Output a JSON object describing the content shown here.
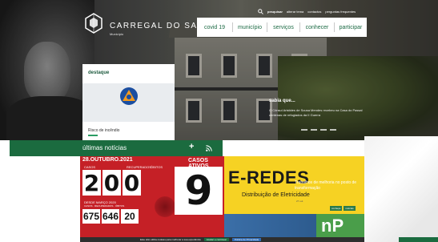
{
  "header": {
    "brand": "CARREGAL DO SAL",
    "brand_sub": "Município",
    "top_links": [
      "pesquisar",
      "alterar tema",
      "contactos",
      "perguntas frequentes"
    ],
    "nav": [
      "covid 19",
      "município",
      "serviços",
      "conhecer",
      "participar"
    ]
  },
  "destaque": {
    "label": "destaque",
    "caption": "Risco de incêndio"
  },
  "sabia": {
    "title": "sabia que...",
    "text": "O Cônsul Aristides de Sousa Mendes recebeu na Casa do Passal centenas de refugiados da II Guerra"
  },
  "news": {
    "title": "últimas notícias",
    "add": "+"
  },
  "covid": {
    "date": "28.OUTUBRO.2021",
    "casos_label": "CASOS",
    "recuperados_label": "RECUPERADOS",
    "obitos_label": "ÓBITOS",
    "digits": [
      "2",
      "0",
      "0"
    ],
    "since_label": "DESDE MARÇO 2020",
    "since_sub": "CASOS · RECUPERADOS · ÓBITOS",
    "totals": [
      "675",
      "646",
      "20"
    ],
    "ativos_label": "CASOS ATIVOS",
    "ativos": "9"
  },
  "eredes": {
    "logo": "E-REDES",
    "sub": "Distribuição de Eletricidade",
    "caption": "Trabalhos de melhoria no posto de transformação",
    "date": "27 out",
    "tags": [
      "conheça",
      "notícias"
    ]
  },
  "np": {
    "text": "nP"
  },
  "cookie": {
    "text": "Este sítio utiliza cookies para melhorar a sua experiência",
    "accept": "Aceitar e continuar",
    "policy": "Política de Privacidade"
  },
  "colors": {
    "brand_green": "#1b6b3f",
    "covid_red": "#c52026",
    "eredes_yellow": "#f6d223"
  }
}
